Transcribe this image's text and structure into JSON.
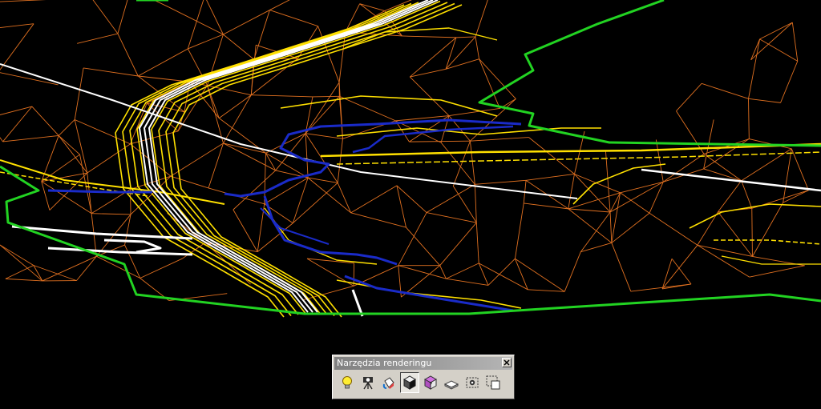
{
  "window": {
    "title": "Narzędzia renderingu"
  },
  "tools": [
    {
      "icon": "light-icon",
      "tooltip": ""
    },
    {
      "icon": "scene-camera-icon",
      "tooltip": ""
    },
    {
      "icon": "materials-icon",
      "tooltip": ""
    },
    {
      "icon": "render-icon",
      "tooltip": "",
      "active": true
    },
    {
      "icon": "render-preferences-icon",
      "tooltip": ""
    },
    {
      "icon": "landscape-icon",
      "tooltip": ""
    },
    {
      "icon": "background-icon",
      "tooltip": ""
    },
    {
      "icon": "region-render-icon",
      "tooltip": ""
    }
  ],
  "colors": {
    "background": "#000000",
    "mesh_edges": "#e07020",
    "contours": "#ffe000",
    "boundary": "#22d322",
    "roads": "#ffffff",
    "river": "#1a2bc8",
    "toolbar_face": "#d4d0c8"
  }
}
